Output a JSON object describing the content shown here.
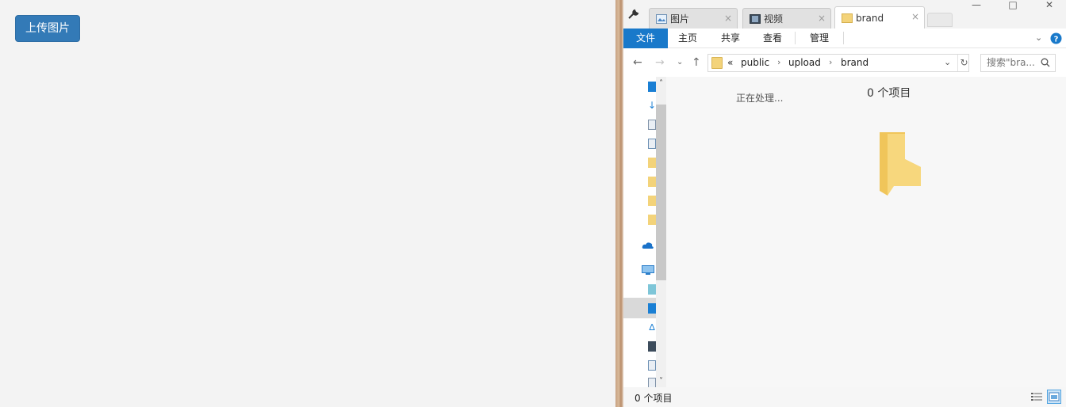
{
  "web": {
    "upload_button": "上传图片"
  },
  "explorer": {
    "tabs": [
      {
        "label": "图片",
        "active": false
      },
      {
        "label": "视频",
        "active": false
      },
      {
        "label": "brand",
        "active": true
      }
    ],
    "tab_close": "×",
    "ribbon": {
      "file": "文件",
      "home": "主页",
      "share": "共享",
      "view": "查看",
      "manage": "管理"
    },
    "address": {
      "overflow": "«",
      "crumbs": [
        "public",
        "upload",
        "brand"
      ],
      "separator": "›"
    },
    "search": {
      "placeholder": "搜索\"bra..."
    },
    "content": {
      "processing": "正在处理...",
      "item_count": "0 个项目"
    },
    "status": {
      "item_count": "0 个项目"
    },
    "colors": {
      "accent": "#1979ca",
      "upload_button": "#337ab7",
      "folder": "#f3d37a"
    }
  }
}
